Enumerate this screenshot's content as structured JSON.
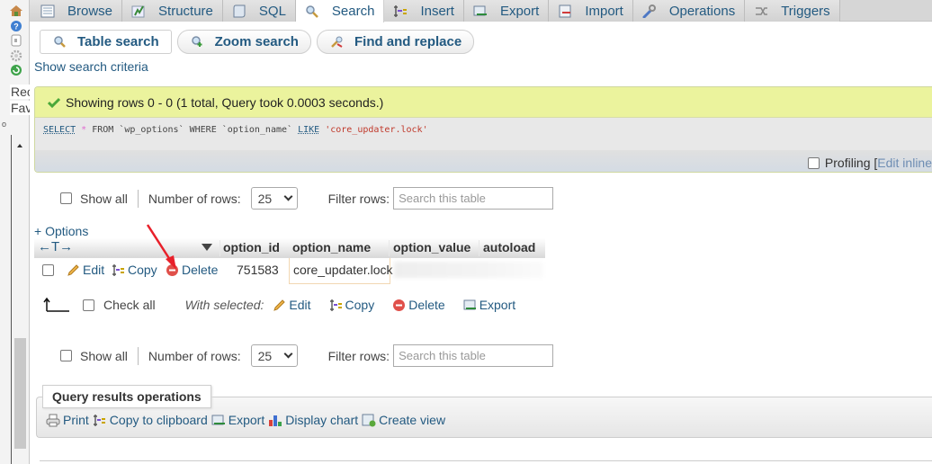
{
  "left_nav": {
    "icons": [
      "home-icon",
      "help-icon",
      "docs-icon",
      "settings-icon",
      "reload-icon"
    ],
    "recent_label": "Recent",
    "favorites_label": "Favorites",
    "o_label": "o"
  },
  "tabs": [
    {
      "label": "Browse",
      "icon": "browse-icon",
      "active": false
    },
    {
      "label": "Structure",
      "icon": "structure-icon",
      "active": false
    },
    {
      "label": "SQL",
      "icon": "sql-icon",
      "active": false
    },
    {
      "label": "Search",
      "icon": "search-icon",
      "active": true
    },
    {
      "label": "Insert",
      "icon": "insert-icon",
      "active": false
    },
    {
      "label": "Export",
      "icon": "export-icon",
      "active": false
    },
    {
      "label": "Import",
      "icon": "import-icon",
      "active": false
    },
    {
      "label": "Operations",
      "icon": "wrench-icon",
      "active": false
    },
    {
      "label": "Triggers",
      "icon": "triggers-icon",
      "active": false
    }
  ],
  "subtabs": [
    {
      "label": "Table search",
      "active": true
    },
    {
      "label": "Zoom search",
      "active": false
    },
    {
      "label": "Find and replace",
      "active": false
    }
  ],
  "show_search_criteria": "Show search criteria",
  "success": {
    "message": "Showing rows 0 - 0 (1 total, Query took 0.0003 seconds.)"
  },
  "sql": {
    "select": "SELECT",
    "star": "*",
    "from": "FROM",
    "table": "`wp_options`",
    "where": "WHERE",
    "column": "`option_name`",
    "like": "LIKE",
    "value": "'core_updater.lock'"
  },
  "profiling": {
    "label": "Profiling",
    "bracket": "[",
    "edit_inline": "Edit inline"
  },
  "nav_controls": {
    "show_all": "Show all",
    "number_of_rows_label": "Number of rows:",
    "number_of_rows_value": "25",
    "filter_rows_label": "Filter rows:",
    "filter_placeholder": "Search this table"
  },
  "plus_options": "+ Options",
  "table": {
    "resize_arrows": "←T→",
    "columns": [
      "option_id",
      "option_name",
      "option_value",
      "autoload"
    ],
    "rows": [
      {
        "actions": {
          "edit": "Edit",
          "copy": "Copy",
          "delete": "Delete"
        },
        "option_id": "751583",
        "option_name": "core_updater.lock",
        "option_value": "",
        "autoload": ""
      }
    ]
  },
  "with_selected": {
    "check_all": "Check all",
    "label": "With selected:",
    "edit": "Edit",
    "copy": "Copy",
    "delete": "Delete",
    "export": "Export"
  },
  "query_results_operations": {
    "legend": "Query results operations",
    "print": "Print",
    "copy_to_clipboard": "Copy to clipboard",
    "export": "Export",
    "display_chart": "Display chart",
    "create_view": "Create view"
  },
  "colors": {
    "link": "#235a81",
    "success_bg": "#ebf39d",
    "annotation_arrow": "#e8202a"
  }
}
